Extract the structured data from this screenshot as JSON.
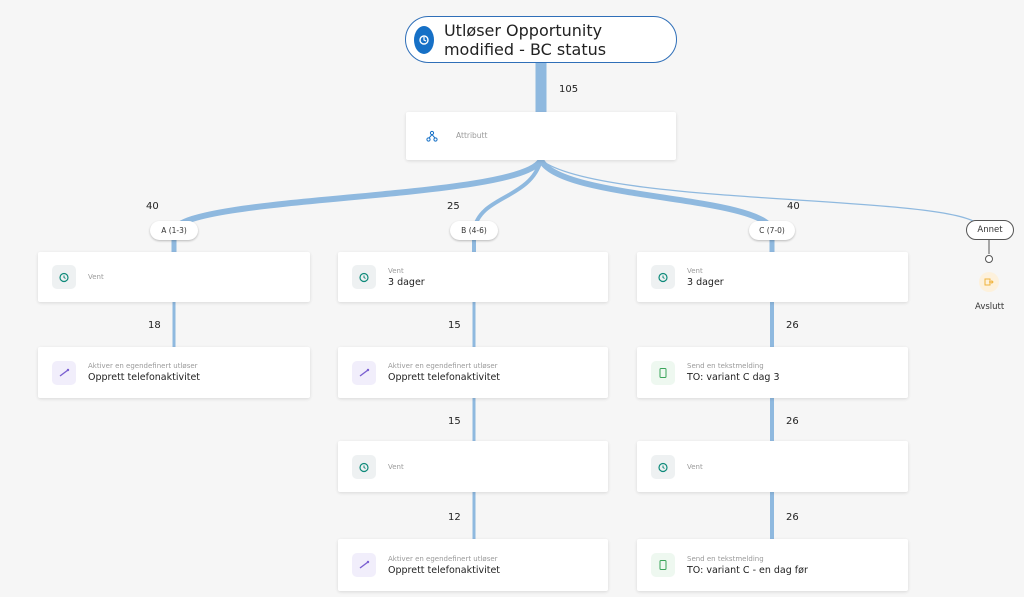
{
  "trigger": {
    "caption": "Utløser",
    "title": "Opportunity modified - BC status"
  },
  "counts": {
    "entry": "105",
    "branch_a": "40",
    "branch_b": "25",
    "branch_c": "40",
    "a1": "18",
    "b1": "15",
    "b2": "15",
    "b3": "12",
    "c1": "26",
    "c2": "26",
    "c3": "26"
  },
  "split_node": {
    "label": "Attributt"
  },
  "branches": {
    "a": "A (1-3)",
    "b": "B (4-6)",
    "c": "C (7-0)",
    "other": "Annet"
  },
  "exit": {
    "label": "Avslutt"
  },
  "nodes": {
    "a_wait": {
      "caption": "Vent",
      "title": ""
    },
    "a_action": {
      "caption": "Aktiver en egendefinert utløser",
      "title": "Opprett telefonaktivitet"
    },
    "b_wait1": {
      "caption": "Vent",
      "title": "3 dager"
    },
    "b_action1": {
      "caption": "Aktiver en egendefinert utløser",
      "title": "Opprett telefonaktivitet"
    },
    "b_wait2": {
      "caption": "Vent",
      "title": ""
    },
    "b_action2": {
      "caption": "Aktiver en egendefinert utløser",
      "title": "Opprett telefonaktivitet"
    },
    "c_wait1": {
      "caption": "Vent",
      "title": "3 dager"
    },
    "c_sms1": {
      "caption": "Send en tekstmelding",
      "title": "TO: variant C dag 3"
    },
    "c_wait2": {
      "caption": "Vent",
      "title": ""
    },
    "c_sms2": {
      "caption": "Send en tekstmelding",
      "title": "TO: variant C - en dag før"
    }
  },
  "icons": {
    "trigger": "trigger-icon",
    "split": "split-icon",
    "wait": "timer-icon",
    "action": "custom-trigger-icon",
    "sms": "text-message-icon",
    "exit": "exit-icon"
  },
  "colors": {
    "flow": "#8fb9df",
    "accent": "#1670c6",
    "exit": "#f0b33c"
  }
}
